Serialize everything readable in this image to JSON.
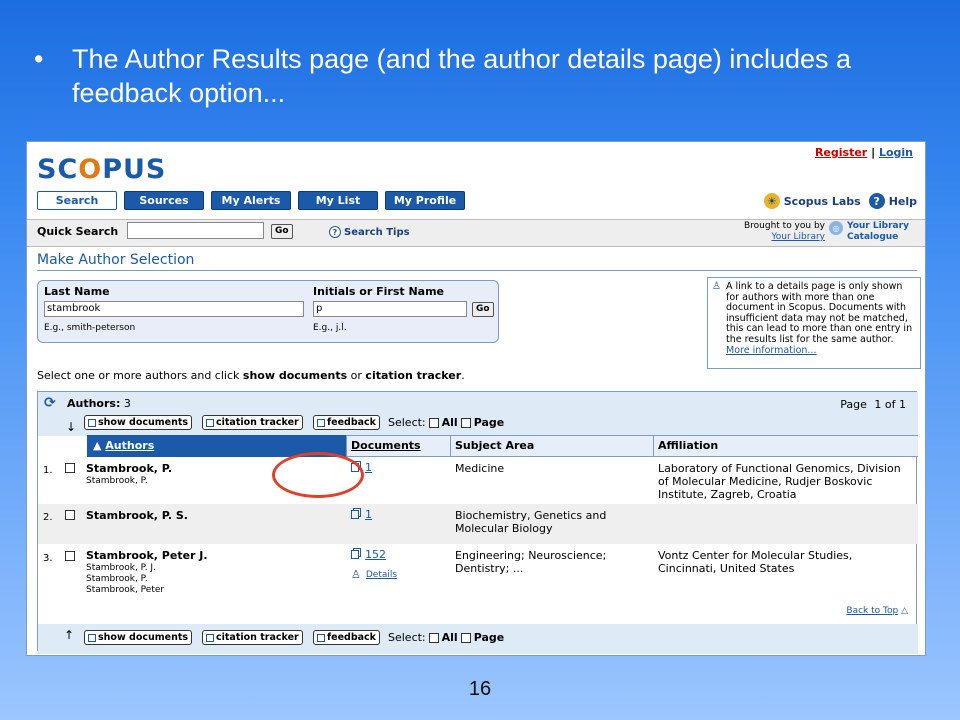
{
  "slide": {
    "bullet_text": "The Author Results page (and the author details page) includes a feedback option...",
    "page_number": "16"
  },
  "app": {
    "logo": {
      "part1": "SC",
      "part2": "O",
      "part3": "PUS"
    },
    "register": "Register",
    "separator": "|",
    "login": "Login",
    "nav": [
      "Search",
      "Sources",
      "My Alerts",
      "My List",
      "My Profile"
    ],
    "labs": "Scopus Labs",
    "help": "Help",
    "quick_search": {
      "label": "Quick Search",
      "value": "",
      "go": "Go",
      "tips": "Search Tips"
    },
    "brought": {
      "line1": "Brought to you by",
      "line2": "Your Library"
    },
    "your_library": {
      "line1": "Your Library",
      "line2": "Catalogue"
    }
  },
  "page": {
    "heading": "Make Author Selection",
    "last_name": {
      "label": "Last Name",
      "value": "stambrook",
      "example": "E.g., smith-peterson"
    },
    "initials": {
      "label": "Initials or First Name",
      "value": "p",
      "example": "E.g., j.l.",
      "go": "Go"
    },
    "info": {
      "text": "A link to a details page is only shown for authors with more than one document in Scopus. Documents with insufficient data may not be matched, this can lead to more than one entry in the results list for the same author.",
      "link": "More information..."
    },
    "instruction": {
      "pre": "Select one or more authors and click ",
      "show_docs": "show documents",
      "or": " or ",
      "tracker": "citation tracker",
      "end": "."
    }
  },
  "results": {
    "authors_label": "Authors:",
    "authors_count": "3",
    "page_label": "Page",
    "page_value": "1 of 1",
    "toolbar": {
      "show_documents": "show documents",
      "citation_tracker": "citation tracker",
      "feedback": "feedback",
      "select": "Select:",
      "all": "All",
      "page": "Page"
    },
    "columns": [
      "Authors",
      "Documents",
      "Subject Area",
      "Affiliation"
    ],
    "rows": [
      {
        "num": "1.",
        "name": "Stambrook, P.",
        "variants": [
          "Stambrook, P."
        ],
        "documents": "1",
        "details": "",
        "subject": "Medicine",
        "affiliation": "Laboratory of Functional Genomics, Division of Molecular Medicine, Rudjer Boskovic Institute, Zagreb, Croatia"
      },
      {
        "num": "2.",
        "name": "Stambrook, P. S.",
        "variants": [],
        "documents": "1",
        "details": "",
        "subject": "Biochemistry, Genetics and Molecular Biology",
        "affiliation": ""
      },
      {
        "num": "3.",
        "name": "Stambrook, Peter J.",
        "variants": [
          "Stambrook, P. J.",
          "Stambrook, P.",
          "Stambrook, Peter"
        ],
        "documents": "152",
        "details": "Details",
        "subject": "Engineering; Neuroscience; Dentistry; ...",
        "affiliation": "Vontz Center for Molecular Studies, Cincinnati, United States"
      }
    ],
    "back_to_top": "Back to Top"
  },
  "colors": {
    "scopus_blue": "#1a5aa8",
    "scopus_orange": "#e07a17",
    "highlight_circle": "#e0402a",
    "register_red": "#cc0000"
  }
}
